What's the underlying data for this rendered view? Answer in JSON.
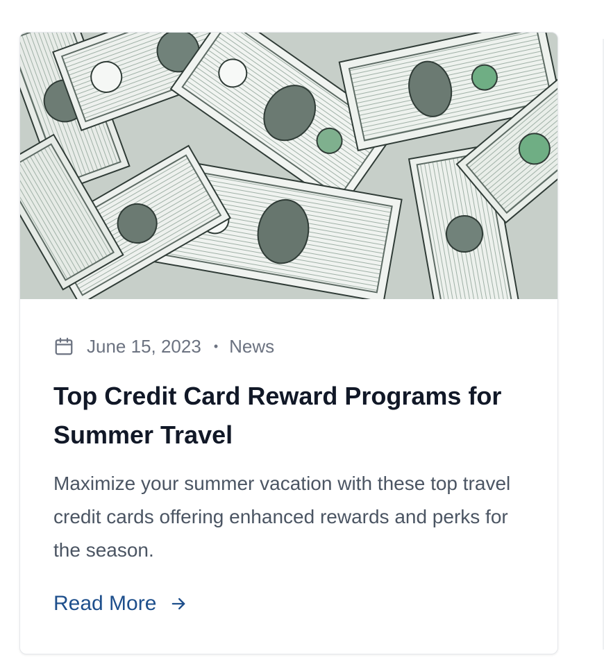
{
  "card": {
    "image_alt": "Scattered US one dollar bills",
    "date": "June 15, 2023",
    "separator": "•",
    "category": "News",
    "title": "Top Credit Card Reward Programs for Summer Travel",
    "excerpt": "Maximize your summer vacation with these top travel credit cards offering enhanced rewards and perks for the season.",
    "read_more_label": "Read More",
    "icons": {
      "date": "calendar-icon",
      "read_more": "arrow-right-icon"
    }
  },
  "colors": {
    "title": "#111827",
    "meta": "#6b7280",
    "excerpt": "#4b5563",
    "link": "#1e4f8c",
    "border": "#e5e7eb",
    "bill_green": "#7d9a83"
  }
}
